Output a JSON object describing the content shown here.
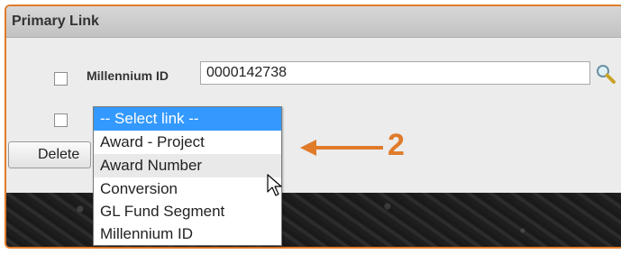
{
  "panel": {
    "title": "Primary Link"
  },
  "row1": {
    "label": "Millennium ID",
    "value": "0000142738",
    "search_icon": "magnifier-icon"
  },
  "row2": {
    "checkbox_checked": false
  },
  "delete_button": {
    "label": "Delete"
  },
  "dropdown": {
    "selected_value": "-- Select link --",
    "options": [
      "-- Select link --",
      "Award - Project",
      "Award Number",
      "Conversion",
      "GL Fund Segment",
      "Millennium ID"
    ],
    "hovered_option": "Award Number"
  },
  "callout": {
    "number": "2",
    "color": "#e07b2a"
  },
  "colors": {
    "accent_orange": "#e07b2a",
    "selection_blue": "#3399ff"
  }
}
